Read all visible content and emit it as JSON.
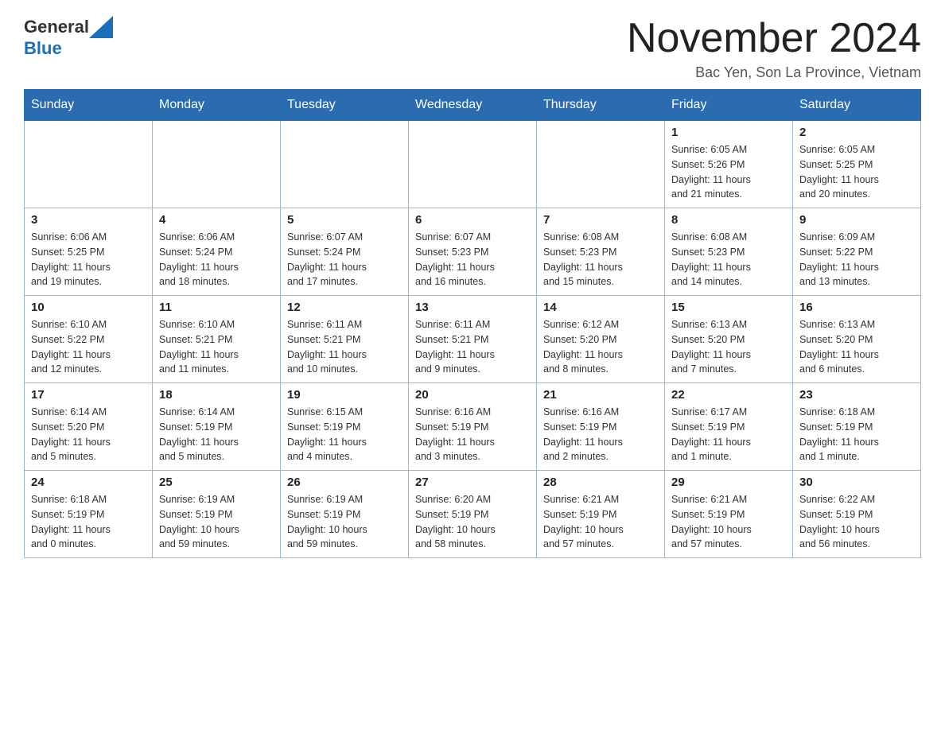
{
  "header": {
    "logo_general": "General",
    "logo_blue": "Blue",
    "title": "November 2024",
    "subtitle": "Bac Yen, Son La Province, Vietnam"
  },
  "days_of_week": [
    "Sunday",
    "Monday",
    "Tuesday",
    "Wednesday",
    "Thursday",
    "Friday",
    "Saturday"
  ],
  "weeks": [
    [
      {
        "day": "",
        "info": ""
      },
      {
        "day": "",
        "info": ""
      },
      {
        "day": "",
        "info": ""
      },
      {
        "day": "",
        "info": ""
      },
      {
        "day": "",
        "info": ""
      },
      {
        "day": "1",
        "info": "Sunrise: 6:05 AM\nSunset: 5:26 PM\nDaylight: 11 hours\nand 21 minutes."
      },
      {
        "day": "2",
        "info": "Sunrise: 6:05 AM\nSunset: 5:25 PM\nDaylight: 11 hours\nand 20 minutes."
      }
    ],
    [
      {
        "day": "3",
        "info": "Sunrise: 6:06 AM\nSunset: 5:25 PM\nDaylight: 11 hours\nand 19 minutes."
      },
      {
        "day": "4",
        "info": "Sunrise: 6:06 AM\nSunset: 5:24 PM\nDaylight: 11 hours\nand 18 minutes."
      },
      {
        "day": "5",
        "info": "Sunrise: 6:07 AM\nSunset: 5:24 PM\nDaylight: 11 hours\nand 17 minutes."
      },
      {
        "day": "6",
        "info": "Sunrise: 6:07 AM\nSunset: 5:23 PM\nDaylight: 11 hours\nand 16 minutes."
      },
      {
        "day": "7",
        "info": "Sunrise: 6:08 AM\nSunset: 5:23 PM\nDaylight: 11 hours\nand 15 minutes."
      },
      {
        "day": "8",
        "info": "Sunrise: 6:08 AM\nSunset: 5:23 PM\nDaylight: 11 hours\nand 14 minutes."
      },
      {
        "day": "9",
        "info": "Sunrise: 6:09 AM\nSunset: 5:22 PM\nDaylight: 11 hours\nand 13 minutes."
      }
    ],
    [
      {
        "day": "10",
        "info": "Sunrise: 6:10 AM\nSunset: 5:22 PM\nDaylight: 11 hours\nand 12 minutes."
      },
      {
        "day": "11",
        "info": "Sunrise: 6:10 AM\nSunset: 5:21 PM\nDaylight: 11 hours\nand 11 minutes."
      },
      {
        "day": "12",
        "info": "Sunrise: 6:11 AM\nSunset: 5:21 PM\nDaylight: 11 hours\nand 10 minutes."
      },
      {
        "day": "13",
        "info": "Sunrise: 6:11 AM\nSunset: 5:21 PM\nDaylight: 11 hours\nand 9 minutes."
      },
      {
        "day": "14",
        "info": "Sunrise: 6:12 AM\nSunset: 5:20 PM\nDaylight: 11 hours\nand 8 minutes."
      },
      {
        "day": "15",
        "info": "Sunrise: 6:13 AM\nSunset: 5:20 PM\nDaylight: 11 hours\nand 7 minutes."
      },
      {
        "day": "16",
        "info": "Sunrise: 6:13 AM\nSunset: 5:20 PM\nDaylight: 11 hours\nand 6 minutes."
      }
    ],
    [
      {
        "day": "17",
        "info": "Sunrise: 6:14 AM\nSunset: 5:20 PM\nDaylight: 11 hours\nand 5 minutes."
      },
      {
        "day": "18",
        "info": "Sunrise: 6:14 AM\nSunset: 5:19 PM\nDaylight: 11 hours\nand 5 minutes."
      },
      {
        "day": "19",
        "info": "Sunrise: 6:15 AM\nSunset: 5:19 PM\nDaylight: 11 hours\nand 4 minutes."
      },
      {
        "day": "20",
        "info": "Sunrise: 6:16 AM\nSunset: 5:19 PM\nDaylight: 11 hours\nand 3 minutes."
      },
      {
        "day": "21",
        "info": "Sunrise: 6:16 AM\nSunset: 5:19 PM\nDaylight: 11 hours\nand 2 minutes."
      },
      {
        "day": "22",
        "info": "Sunrise: 6:17 AM\nSunset: 5:19 PM\nDaylight: 11 hours\nand 1 minute."
      },
      {
        "day": "23",
        "info": "Sunrise: 6:18 AM\nSunset: 5:19 PM\nDaylight: 11 hours\nand 1 minute."
      }
    ],
    [
      {
        "day": "24",
        "info": "Sunrise: 6:18 AM\nSunset: 5:19 PM\nDaylight: 11 hours\nand 0 minutes."
      },
      {
        "day": "25",
        "info": "Sunrise: 6:19 AM\nSunset: 5:19 PM\nDaylight: 10 hours\nand 59 minutes."
      },
      {
        "day": "26",
        "info": "Sunrise: 6:19 AM\nSunset: 5:19 PM\nDaylight: 10 hours\nand 59 minutes."
      },
      {
        "day": "27",
        "info": "Sunrise: 6:20 AM\nSunset: 5:19 PM\nDaylight: 10 hours\nand 58 minutes."
      },
      {
        "day": "28",
        "info": "Sunrise: 6:21 AM\nSunset: 5:19 PM\nDaylight: 10 hours\nand 57 minutes."
      },
      {
        "day": "29",
        "info": "Sunrise: 6:21 AM\nSunset: 5:19 PM\nDaylight: 10 hours\nand 57 minutes."
      },
      {
        "day": "30",
        "info": "Sunrise: 6:22 AM\nSunset: 5:19 PM\nDaylight: 10 hours\nand 56 minutes."
      }
    ]
  ]
}
